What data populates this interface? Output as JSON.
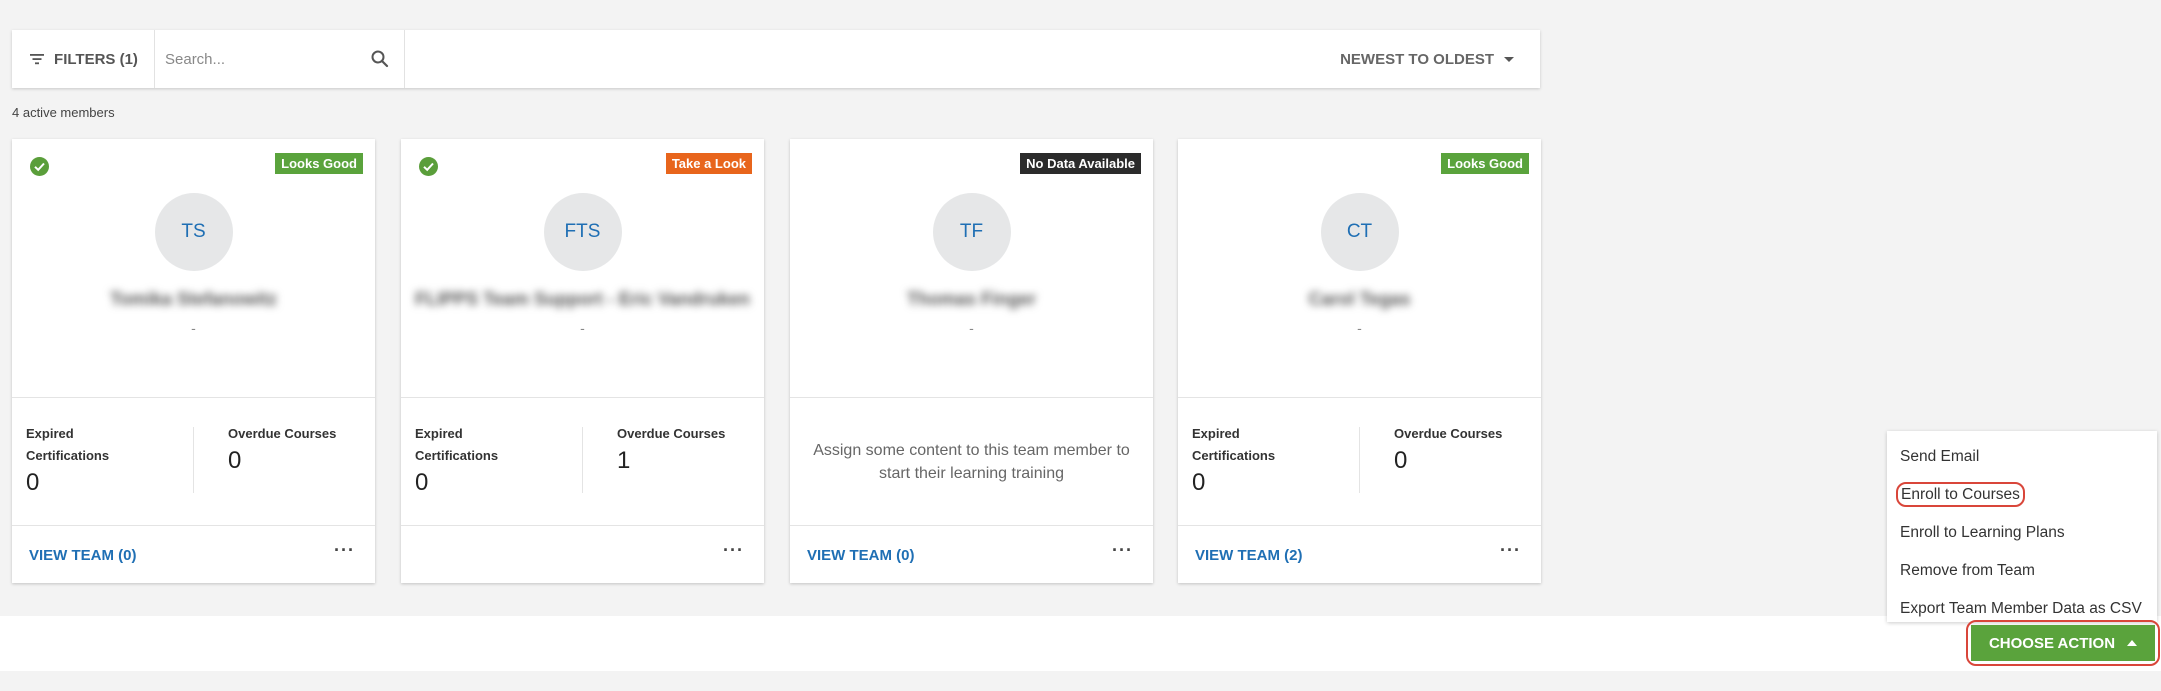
{
  "toolbar": {
    "filters_label": "FILTERS (1)",
    "search_placeholder": "Search...",
    "sort_label": "NEWEST TO OLDEST"
  },
  "member_count": "4 active members",
  "cards": [
    {
      "initials": "TS",
      "name": "Tomika Stefanowitz",
      "subtitle": "-",
      "badge": "Looks Good",
      "badge_color": "#5aa33c",
      "checked": true,
      "expired_label": "Expired Certifications",
      "expired_value": "0",
      "overdue_label": "Overdue Courses",
      "overdue_value": "0",
      "view_team": "VIEW TEAM (0)",
      "more": "···"
    },
    {
      "initials": "FTS",
      "name": "FLIPPS Team Support - Eric Vandruken",
      "subtitle": "-",
      "badge": "Take a Look",
      "badge_color": "#e8651c",
      "checked": true,
      "expired_label": "Expired Certifications",
      "expired_value": "0",
      "overdue_label": "Overdue Courses",
      "overdue_value": "1",
      "view_team": "",
      "more": "···"
    },
    {
      "initials": "TF",
      "name": "Thomas Finger",
      "subtitle": "-",
      "badge": "No Data Available",
      "badge_color": "#2b2b2b",
      "checked": false,
      "assign_message": "Assign some content to this team member to start their learning training",
      "view_team": "VIEW TEAM (0)",
      "more": "···"
    },
    {
      "initials": "CT",
      "name": "Carol Tegas",
      "subtitle": "-",
      "badge": "Looks Good",
      "badge_color": "#5aa33c",
      "checked": false,
      "expired_label": "Expired Certifications",
      "expired_value": "0",
      "overdue_label": "Overdue Courses",
      "overdue_value": "0",
      "view_team": "VIEW TEAM (2)",
      "more": "···"
    }
  ],
  "action_menu": {
    "items": [
      "Send Email",
      "Enroll to Courses",
      "Enroll to Learning Plans",
      "Remove from Team",
      "Export Team Member Data as CSV"
    ],
    "highlighted_item": "Enroll to Courses",
    "button_label": "CHOOSE ACTION"
  },
  "colors": {
    "accent_blue": "#1f6fb4",
    "action_green": "#5aa33c",
    "highlight_red": "#d9463a"
  }
}
